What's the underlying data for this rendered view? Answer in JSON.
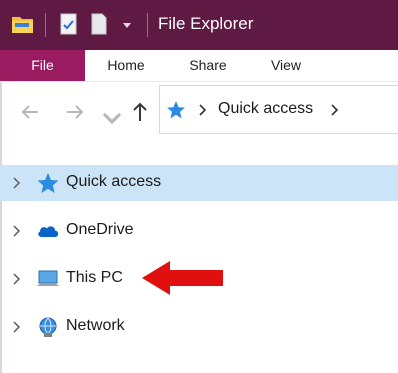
{
  "window": {
    "title": "File Explorer"
  },
  "quick_access_toolbar": {
    "icons": [
      "folder-icon",
      "properties-icon",
      "new-folder-icon",
      "dropdown-icon"
    ]
  },
  "ribbon": {
    "tabs": [
      {
        "label": "File",
        "active": true
      },
      {
        "label": "Home"
      },
      {
        "label": "Share"
      },
      {
        "label": "View"
      }
    ]
  },
  "address_bar": {
    "breadcrumb": "Quick access"
  },
  "navigation_pane": {
    "items": [
      {
        "label": "Quick access",
        "icon": "star-icon",
        "selected": true
      },
      {
        "label": "OneDrive",
        "icon": "cloud-icon"
      },
      {
        "label": "This PC",
        "icon": "computer-icon"
      },
      {
        "label": "Network",
        "icon": "network-icon"
      }
    ]
  },
  "colors": {
    "titlebar": "#5e1a43",
    "file_tab": "#9b1b60",
    "selection": "#cce4f7",
    "annotation_arrow": "#e01010"
  }
}
